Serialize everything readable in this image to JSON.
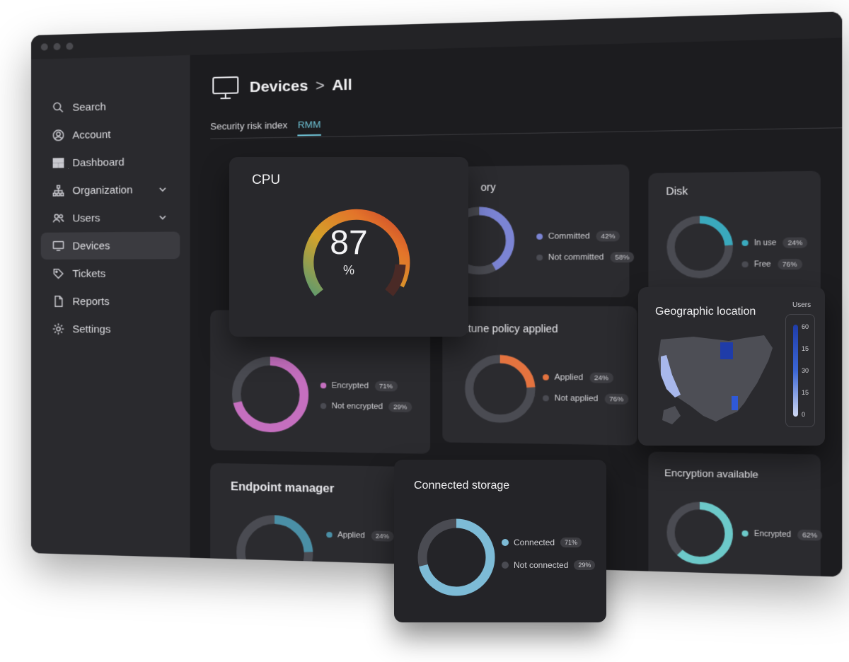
{
  "sidebar": {
    "items": [
      {
        "label": "Search",
        "icon": "search-icon"
      },
      {
        "label": "Account",
        "icon": "account-icon"
      },
      {
        "label": "Dashboard",
        "icon": "dashboard-icon"
      },
      {
        "label": "Organization",
        "icon": "organization-icon"
      },
      {
        "label": "Users",
        "icon": "users-icon"
      },
      {
        "label": "Devices",
        "icon": "monitor-icon"
      },
      {
        "label": "Tickets",
        "icon": "tag-icon"
      },
      {
        "label": "Reports",
        "icon": "document-icon"
      },
      {
        "label": "Settings",
        "icon": "gear-icon"
      }
    ]
  },
  "header": {
    "title": "Devices",
    "separator": ">",
    "sub": "All"
  },
  "tabs": [
    {
      "label": "Security risk index"
    },
    {
      "label": "RMM"
    }
  ],
  "cards": {
    "memory": {
      "title": "ory",
      "l1": "Committed",
      "v1": "42%",
      "l2": "Not committed",
      "v2": "58%"
    },
    "disk": {
      "title": "Disk",
      "l1": "In use",
      "v1": "24%",
      "l2": "Free",
      "v2": "76%"
    },
    "bitlocker": {
      "l1": "Encrypted",
      "v1": "71%",
      "l2": "Not encrypted",
      "v2": "29%"
    },
    "intune": {
      "title": "Intune policy applied",
      "l1": "Applied",
      "v1": "24%",
      "l2": "Not applied",
      "v2": "76%"
    },
    "endpoint": {
      "title": "Endpoint manager",
      "l1": "Applied",
      "v1": "24%"
    },
    "encavail": {
      "title": "Encryption available",
      "l1": "Encrypted",
      "v1": "62%"
    }
  },
  "cpu": {
    "title": "CPU",
    "value": "87",
    "unit": "%"
  },
  "geo": {
    "title": "Geographic location",
    "legend_title": "Users",
    "ticks": [
      "60",
      "15",
      "30",
      "15",
      "0"
    ]
  },
  "storage": {
    "title": "Connected storage",
    "l1": "Connected",
    "v1": "71%",
    "l2": "Not connected",
    "v2": "29%"
  },
  "colors": {
    "memory": "#7b84d4",
    "disk": "#3aa9bd",
    "bitlocker": "#c56fbf",
    "intune": "#e4733f",
    "endpoint": "#4a8fa6",
    "encavail": "#6cc9c9",
    "storage": "#7dbbd6",
    "rest": "#4a4b52"
  }
}
